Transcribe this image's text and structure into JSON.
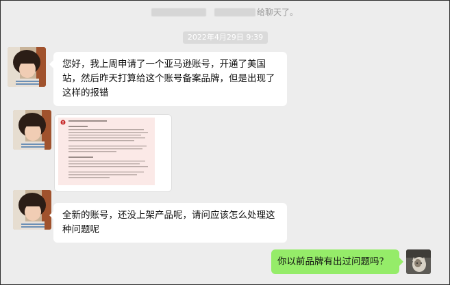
{
  "system_notice": {
    "text": "给聊天了。"
  },
  "timestamp": "2022年4月29日 9:39",
  "messages": [
    {
      "side": "left",
      "type": "text",
      "text": "您好，我上周申请了一个亚马逊账号，开通了美国站，然后昨天打算给这个账号备案品牌，但是出现了这样的报错"
    },
    {
      "side": "left",
      "type": "image",
      "image_icon": "error-screenshot-icon"
    },
    {
      "side": "left",
      "type": "text",
      "text": "全新的账号，还没上架产品呢，请问应该怎么处理这种问题呢"
    },
    {
      "side": "right",
      "type": "text",
      "text": "你以前品牌有出过问题吗？"
    }
  ],
  "colors": {
    "background": "#ededed",
    "incoming_bubble": "#ffffff",
    "outgoing_bubble": "#95ec69",
    "timestamp_bg": "#dadada",
    "error_red": "#c62828"
  }
}
